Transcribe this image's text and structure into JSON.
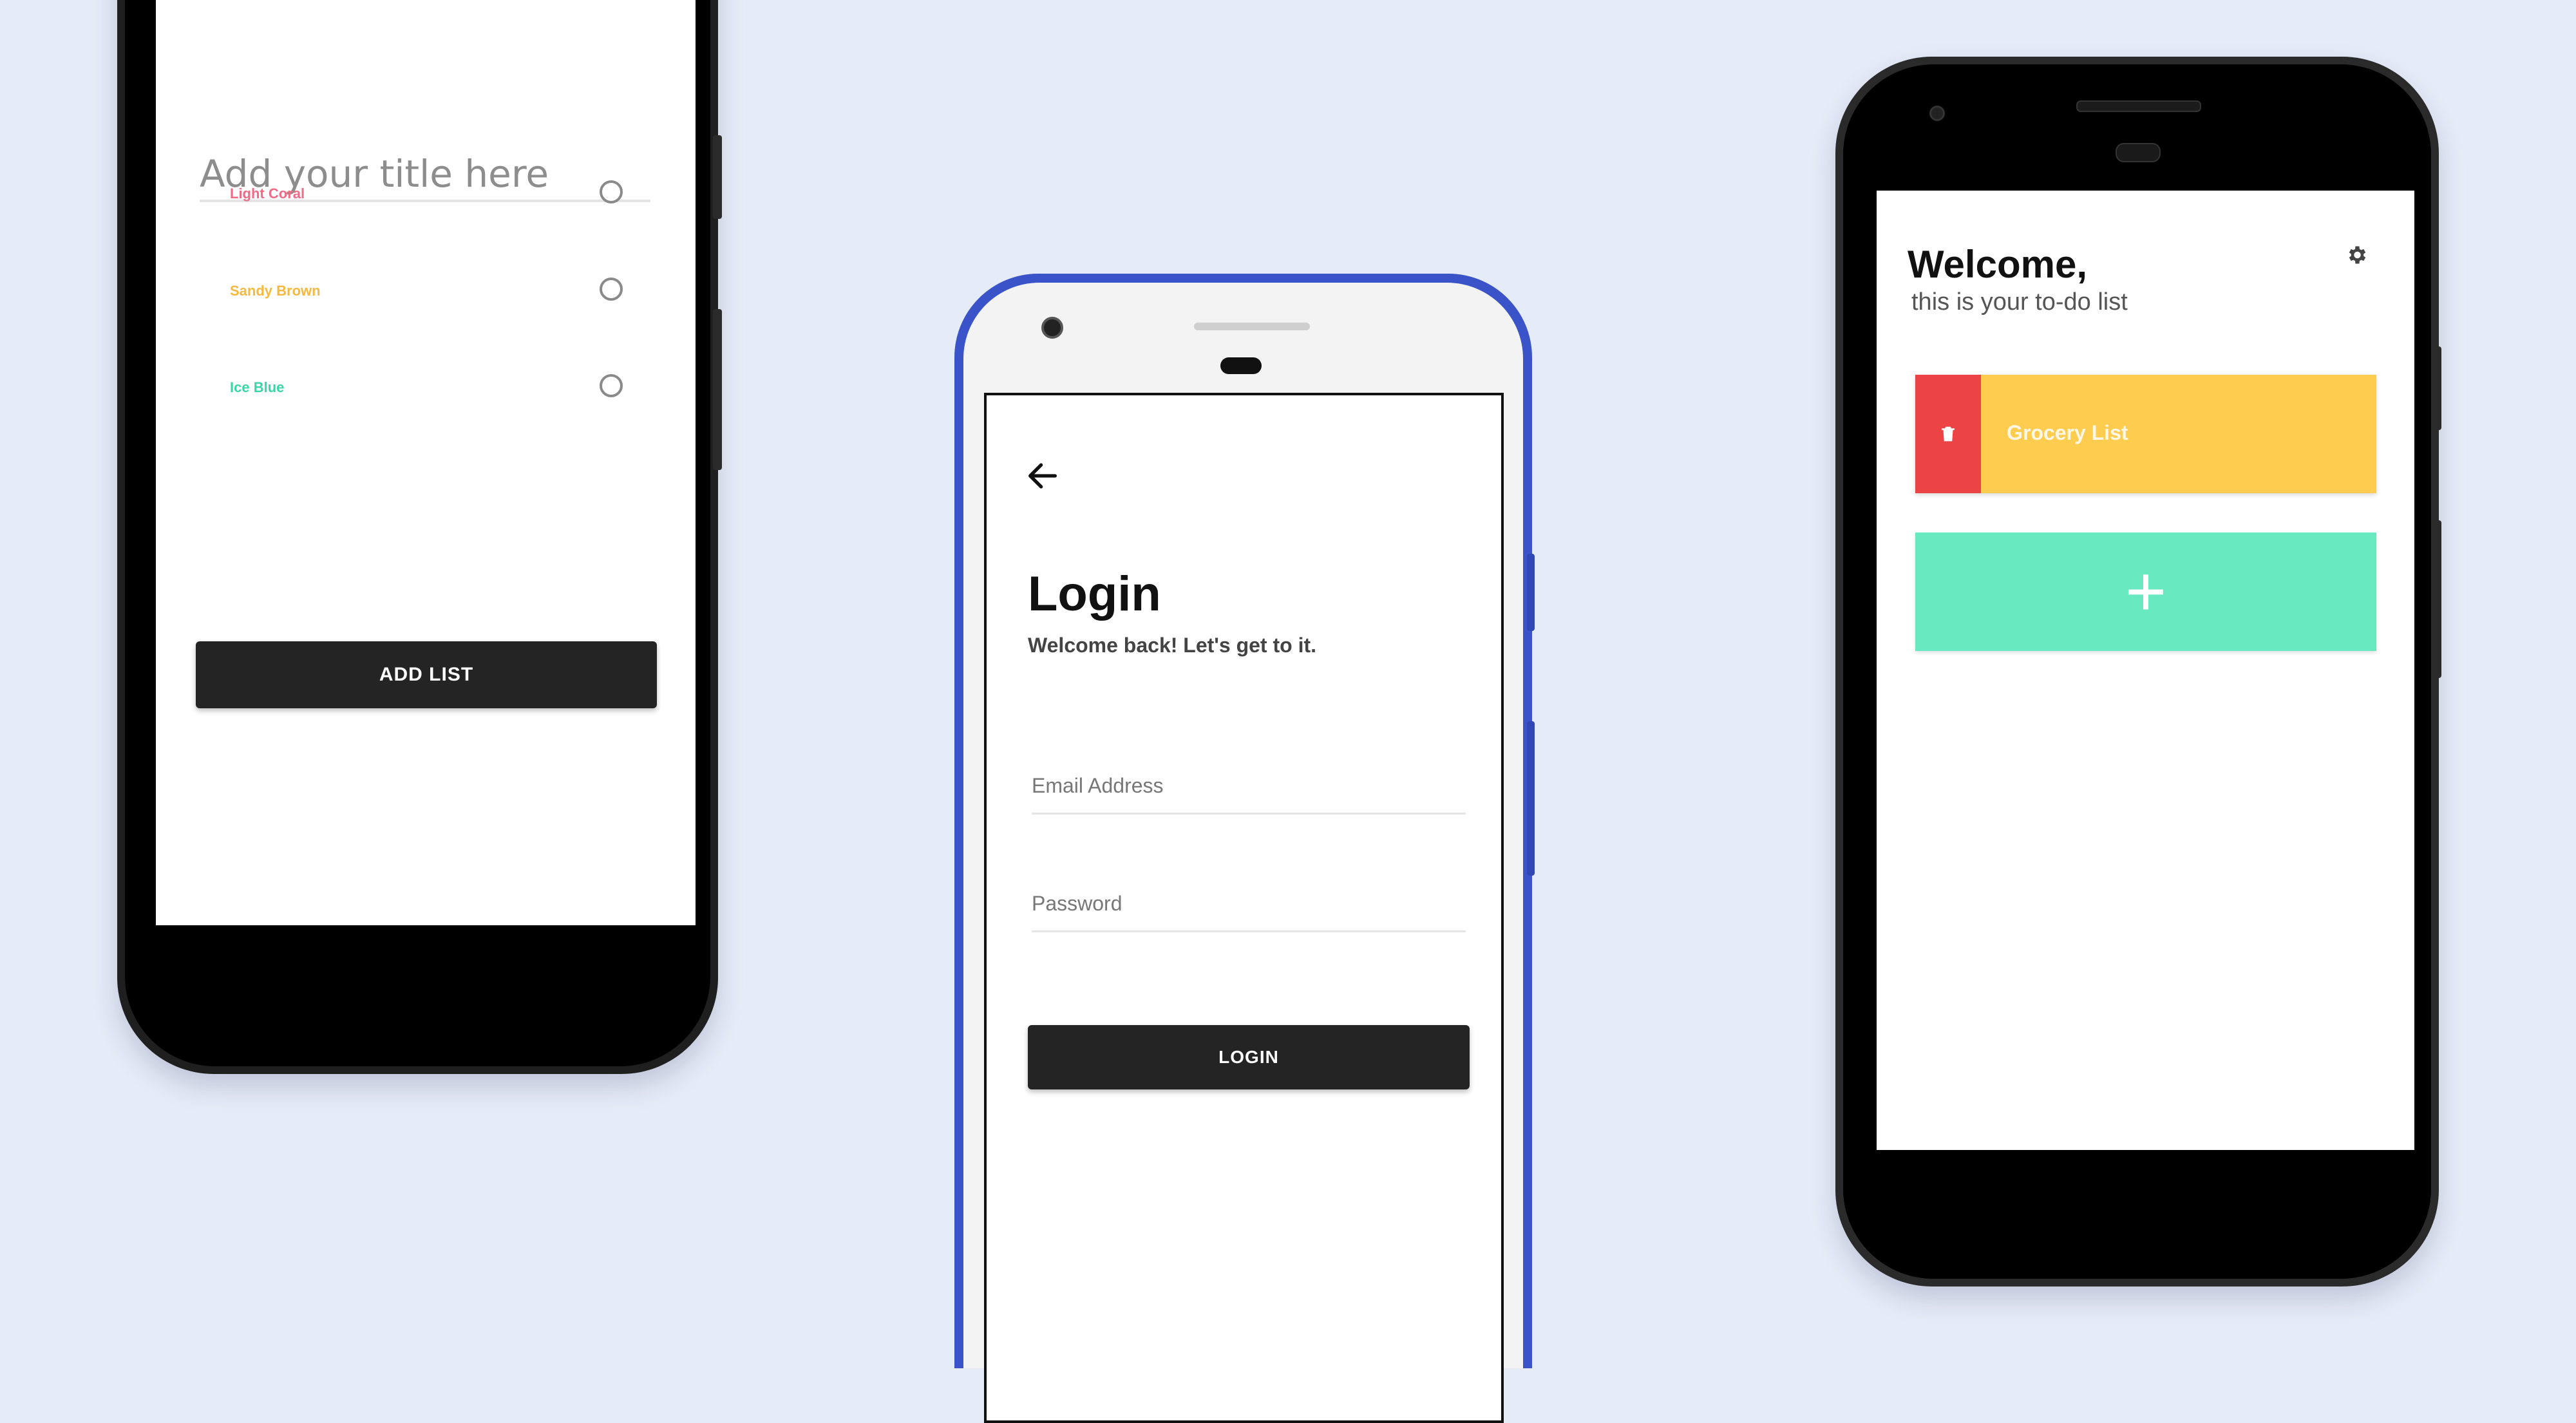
{
  "create_list_screen": {
    "title_placeholder": "Add your title here",
    "colors": [
      {
        "label": "Light Coral",
        "color": "#f06b86"
      },
      {
        "label": "Sandy Brown",
        "color": "#f5b93f"
      },
      {
        "label": "Ice Blue",
        "color": "#39d7a8"
      }
    ],
    "add_button_label": "ADD LIST"
  },
  "login_screen": {
    "title": "Login",
    "subtitle": "Welcome back! Let's get to it.",
    "email_placeholder": "Email Address",
    "password_placeholder": "Password",
    "login_button_label": "LOGIN"
  },
  "home_screen": {
    "greeting": "Welcome,",
    "subtitle": "this is your to-do list",
    "lists": [
      {
        "name": "Grocery List",
        "color": "#fecd50"
      }
    ],
    "add_button_symbol": "+",
    "icons": [
      "gear-icon",
      "trash-icon",
      "arrow-left-icon"
    ]
  },
  "theme": {
    "background": "#e6ebf8",
    "dark_button": "#242424",
    "delete_red": "#ec4444",
    "add_green": "#69e9bf"
  }
}
